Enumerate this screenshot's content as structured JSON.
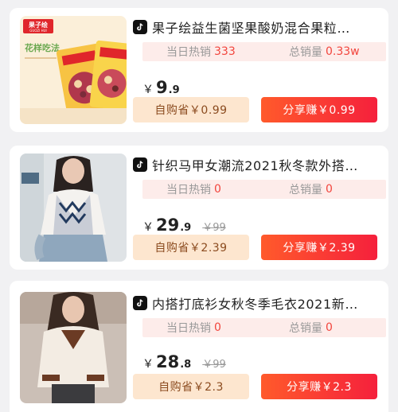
{
  "products": [
    {
      "title": "果子绘益生菌坚果酸奶混合果粒…",
      "stats": {
        "daily_label": "当日热销",
        "daily_value": "333",
        "total_label": "总销量",
        "total_value": "0.33w"
      },
      "price": {
        "currency": "￥",
        "integer": "9",
        "decimal": ".9",
        "original": ""
      },
      "self_buy_label": "自购省￥0.99",
      "share_label": "分享赚￥0.99",
      "thumb": {
        "brand": "果子绘",
        "brand_sub": "GUOZI HUI",
        "slogan": "花样吃法"
      }
    },
    {
      "title": "针织马甲女潮流2021秋冬款外搭…",
      "stats": {
        "daily_label": "当日热销",
        "daily_value": "0",
        "total_label": "总销量",
        "total_value": "0"
      },
      "price": {
        "currency": "￥",
        "integer": "29",
        "decimal": ".9",
        "original": "￥99"
      },
      "self_buy_label": "自购省￥2.39",
      "share_label": "分享赚￥2.39"
    },
    {
      "title": "内搭打底衫女秋冬季毛衣2021新…",
      "stats": {
        "daily_label": "当日热销",
        "daily_value": "0",
        "total_label": "总销量",
        "total_value": "0"
      },
      "price": {
        "currency": "￥",
        "integer": "28",
        "decimal": ".8",
        "original": "￥99"
      },
      "self_buy_label": "自购省￥2.3",
      "share_label": "分享赚￥2.3"
    }
  ],
  "colors": {
    "accent": "#f2453d",
    "share_button": "#f5203c",
    "self_buy_bg": "#fde6cf",
    "stats_bg": "#fdecea"
  },
  "icons": {
    "platform": "tiktok-icon"
  }
}
